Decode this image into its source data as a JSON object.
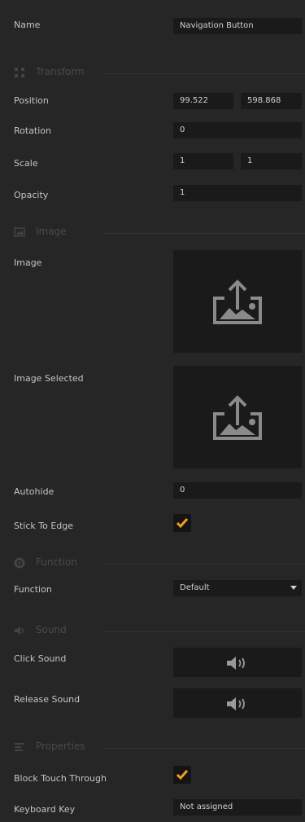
{
  "name": {
    "label": "Name",
    "value": "Navigation Button"
  },
  "transform": {
    "title": "Transform",
    "position": {
      "label": "Position",
      "x": "99.522",
      "y": "598.868"
    },
    "rotation": {
      "label": "Rotation",
      "value": "0"
    },
    "scale": {
      "label": "Scale",
      "x": "1",
      "y": "1"
    },
    "opacity": {
      "label": "Opacity",
      "value": "1"
    }
  },
  "image": {
    "title": "Image",
    "image_label": "Image",
    "image_selected_label": "Image Selected",
    "autohide": {
      "label": "Autohide",
      "value": "0"
    },
    "stick_to_edge": {
      "label": "Stick To Edge",
      "checked": true
    }
  },
  "function_section": {
    "title": "Function",
    "function": {
      "label": "Function",
      "value": "Default"
    }
  },
  "sound": {
    "title": "Sound",
    "click_label": "Click Sound",
    "release_label": "Release Sound"
  },
  "properties": {
    "title": "Properties",
    "block_touch": {
      "label": "Block Touch Through",
      "checked": true
    },
    "keyboard_key": {
      "label": "Keyboard Key",
      "value": "Not assigned"
    }
  },
  "colors": {
    "accent": "#f0a020",
    "background": "#262626",
    "field": "#1a1a1a"
  }
}
